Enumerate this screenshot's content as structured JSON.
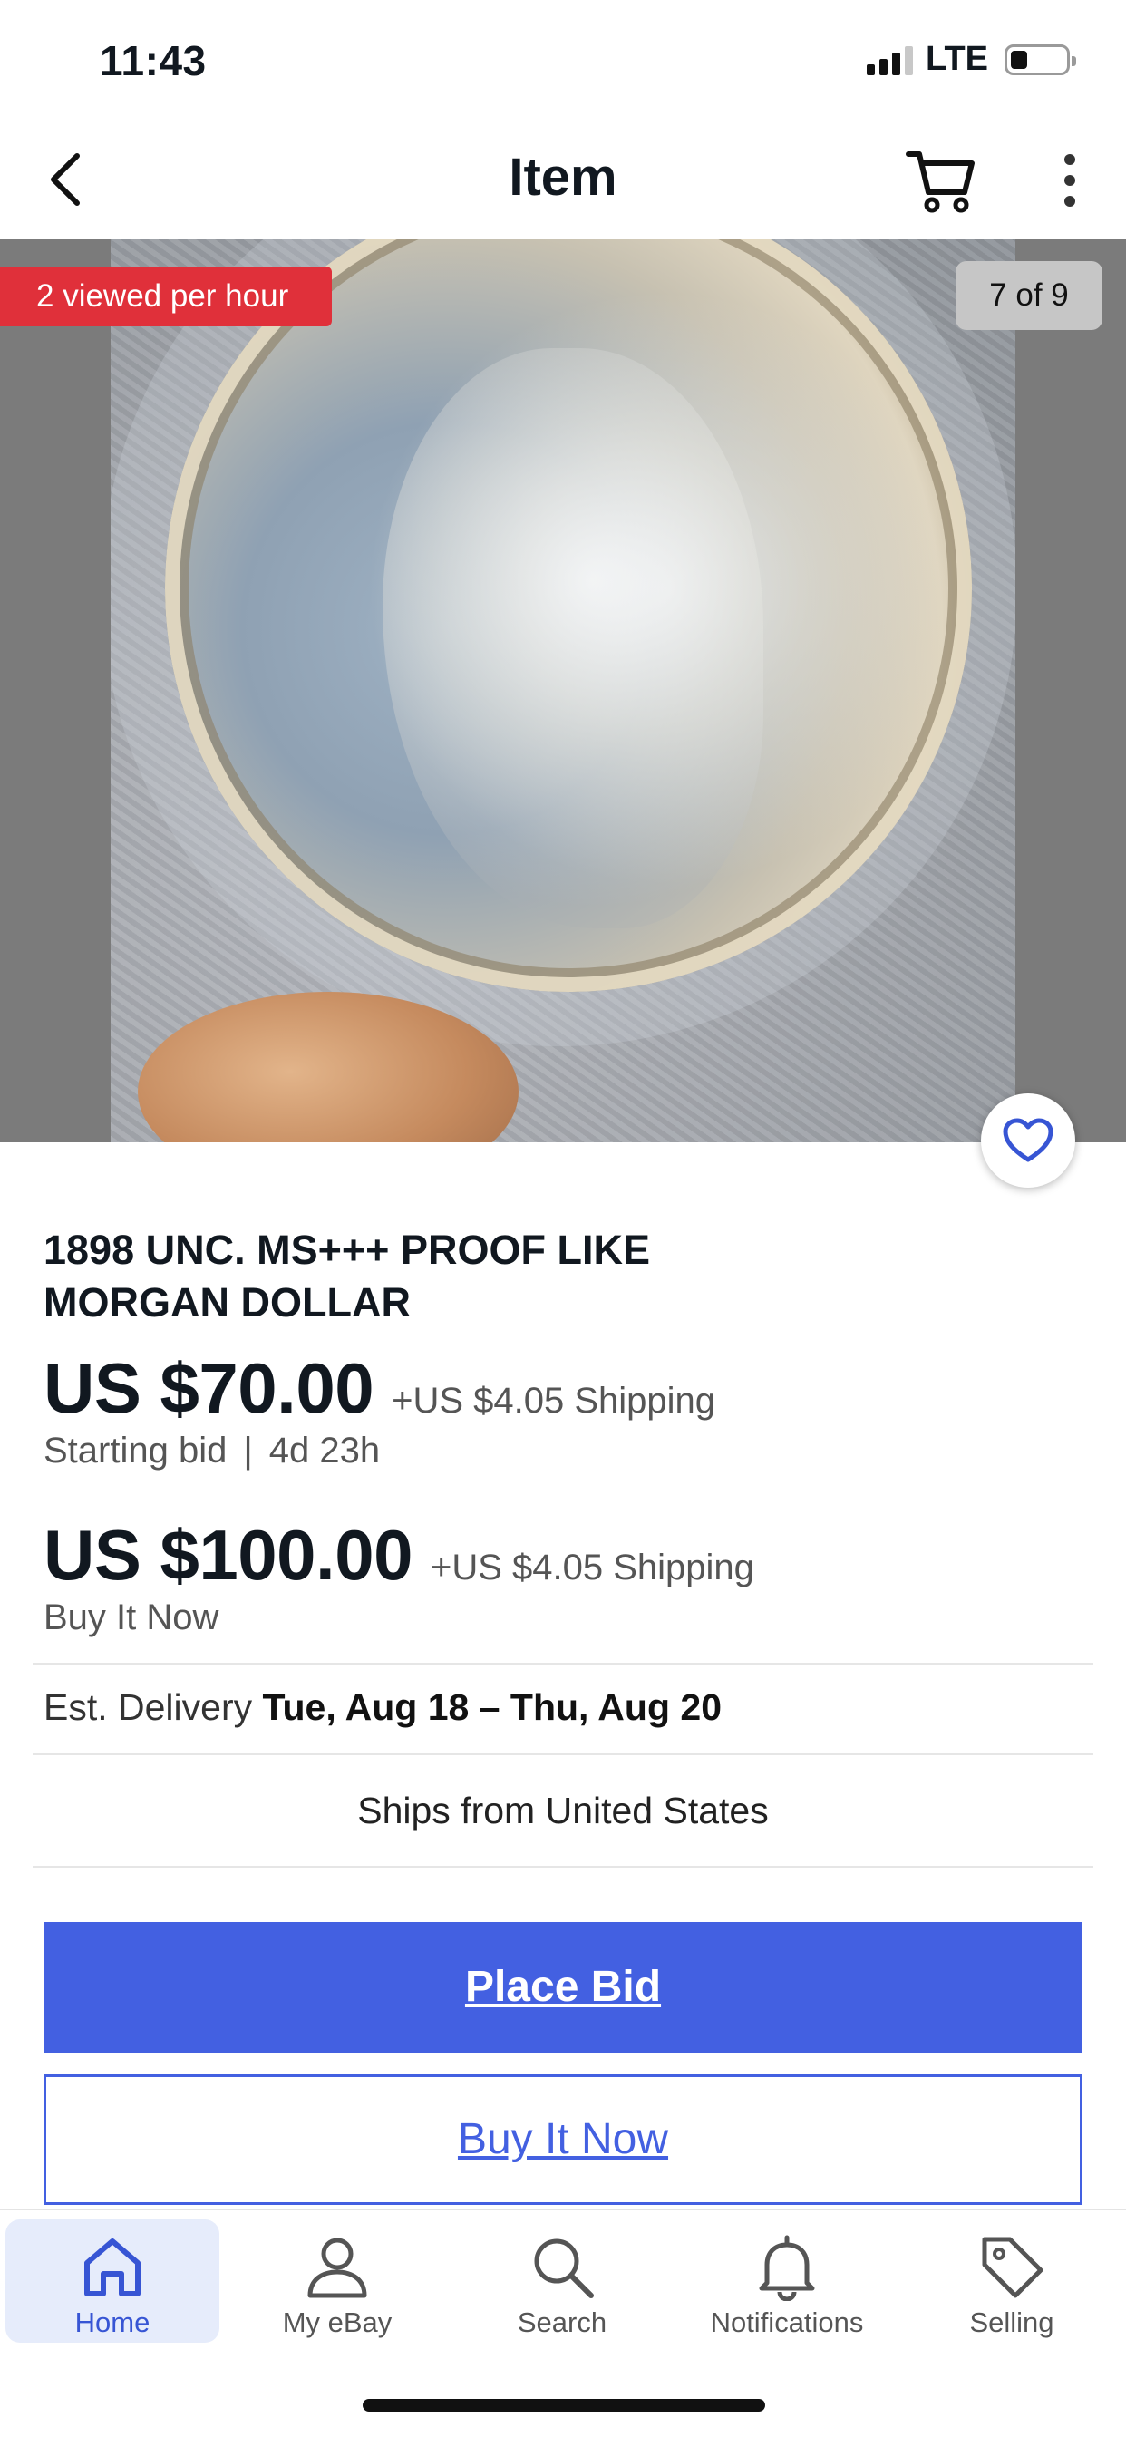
{
  "status_bar": {
    "time": "11:43",
    "network": "LTE"
  },
  "nav": {
    "title": "Item",
    "icons": [
      "chevron-left-icon",
      "cart-icon",
      "more-vertical-icon"
    ]
  },
  "hero": {
    "views_badge": "2 viewed per hour",
    "photo_counter": "7 of 9",
    "watch_icon": "heart-icon"
  },
  "item": {
    "title_line1": "1898 UNC. MS+++ PROOF LIKE",
    "title_line2": "MORGAN DOLLAR",
    "bid_price": "US $70.00",
    "bid_shipping": "+US $4.05 Shipping",
    "bid_label": "Starting bid",
    "bid_separator": "|",
    "time_left": "4d 23h",
    "bin_price": "US $100.00",
    "bin_shipping": "+US $4.05 Shipping",
    "bin_label": "Buy It Now"
  },
  "delivery": {
    "label": "Est. Delivery",
    "dates": "Tue, Aug 18 – Thu, Aug 20",
    "ships_from": "Ships from United States"
  },
  "actions": {
    "place_bid": "Place Bid",
    "buy_it_now": "Buy It Now"
  },
  "tabs": [
    {
      "label": "Home",
      "icon": "home-icon",
      "active": true
    },
    {
      "label": "My eBay",
      "icon": "person-icon",
      "active": false
    },
    {
      "label": "Search",
      "icon": "search-icon",
      "active": false
    },
    {
      "label": "Notifications",
      "icon": "bell-icon",
      "active": false
    },
    {
      "label": "Selling",
      "icon": "tag-icon",
      "active": false
    }
  ],
  "colors": {
    "accent": "#4360e1",
    "badge": "#e0303a",
    "active_tab_bg": "#e6ecfb"
  }
}
